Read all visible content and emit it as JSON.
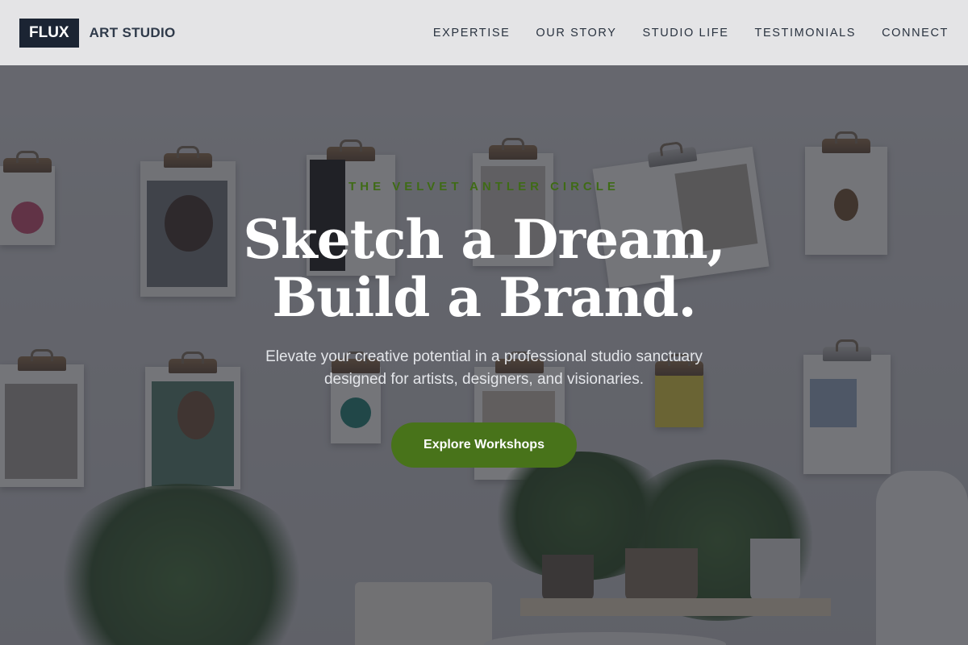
{
  "header": {
    "logo_badge": "FLUX",
    "logo_text": "ART STUDIO",
    "nav": [
      {
        "label": "EXPERTISE"
      },
      {
        "label": "OUR STORY"
      },
      {
        "label": "STUDIO LIFE"
      },
      {
        "label": "TESTIMONIALS"
      },
      {
        "label": "CONNECT"
      }
    ]
  },
  "hero": {
    "eyebrow": "THE VELVET ANTLER CIRCLE",
    "headline_line1": "Sketch a Dream,",
    "headline_line2": "Build a Brand.",
    "subtext_line1": "Elevate your creative potential in a professional studio sanctuary",
    "subtext_line2": "designed for artists, designers, and visionaries.",
    "cta_label": "Explore Workshops"
  },
  "colors": {
    "brand_dark": "#1b2433",
    "accent_green": "#48731a",
    "eyebrow_green": "#3f6b16",
    "header_bg": "#ececee"
  },
  "background": {
    "description_icon": "studio-wall-photo"
  }
}
